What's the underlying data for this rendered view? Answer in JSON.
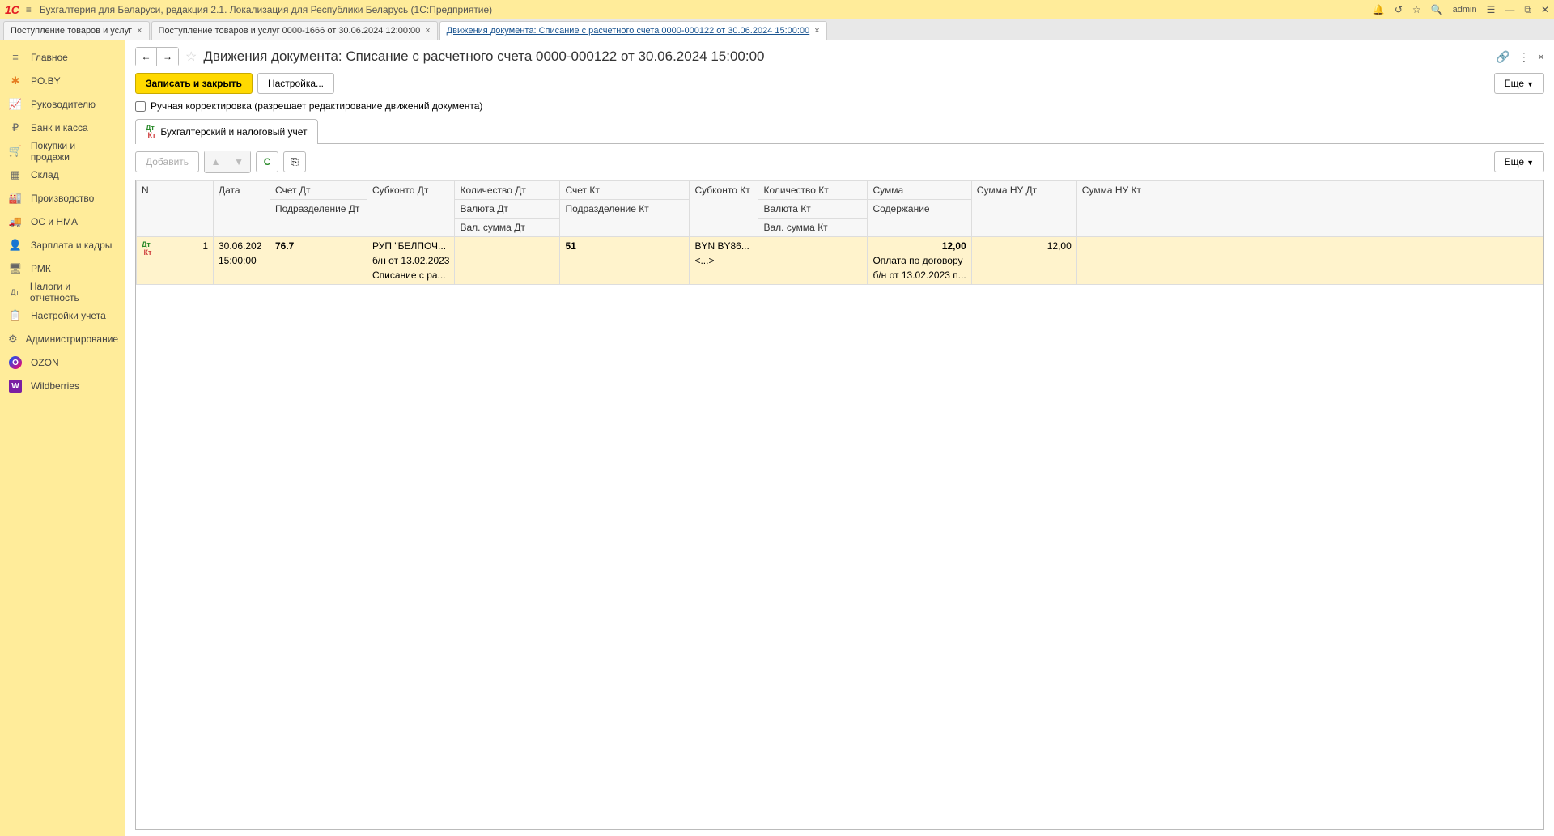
{
  "titlebar": {
    "app_name": "Бухгалтерия для Беларуси, редакция 2.1. Локализация для Республики Беларусь   (1С:Предприятие)",
    "user": "admin"
  },
  "tabs": [
    {
      "label": "Поступление товаров и услуг",
      "active": false,
      "highlight": false
    },
    {
      "label": "Поступление товаров и услуг 0000-1666 от 30.06.2024 12:00:00",
      "active": false,
      "highlight": false
    },
    {
      "label": "Движения документа: Списание с расчетного счета 0000-000122 от 30.06.2024 15:00:00",
      "active": true,
      "highlight": true
    }
  ],
  "sidebar": {
    "items": [
      {
        "label": "Главное",
        "icon": "≡",
        "cls": "ic-gray"
      },
      {
        "label": "PO.BY",
        "icon": "✱",
        "cls": "ic-orange"
      },
      {
        "label": "Руководителю",
        "icon": "📈",
        "cls": "ic-gray"
      },
      {
        "label": "Банк и касса",
        "icon": "₽",
        "cls": "ic-gray"
      },
      {
        "label": "Покупки и продажи",
        "icon": "🛒",
        "cls": "ic-gray"
      },
      {
        "label": "Склад",
        "icon": "▦",
        "cls": "ic-gray"
      },
      {
        "label": "Производство",
        "icon": "🏭",
        "cls": "ic-gray"
      },
      {
        "label": "ОС и НМА",
        "icon": "🚚",
        "cls": "ic-gray"
      },
      {
        "label": "Зарплата и кадры",
        "icon": "👤",
        "cls": "ic-gray"
      },
      {
        "label": "РМК",
        "icon": "🖥",
        "cls": "ic-gray"
      },
      {
        "label": "Налоги и отчетность",
        "icon": "Дт",
        "cls": "ic-gray"
      },
      {
        "label": "Настройки учета",
        "icon": "📋",
        "cls": "ic-gray"
      },
      {
        "label": "Администрирование",
        "icon": "⚙",
        "cls": "ic-gray"
      },
      {
        "label": "OZON",
        "icon": "O",
        "cls": "ic-ozon"
      },
      {
        "label": "Wildberries",
        "icon": "W",
        "cls": "ic-wb"
      }
    ]
  },
  "page": {
    "title": "Движения документа: Списание с расчетного счета 0000-000122 от 30.06.2024 15:00:00",
    "save_close": "Записать и закрыть",
    "settings": "Настройка...",
    "more": "Еще",
    "checkbox_label": "Ручная корректировка (разрешает редактирование движений документа)",
    "inner_tab": "Бухгалтерский и налоговый учет",
    "add": "Добавить"
  },
  "table": {
    "headers": {
      "n": "N",
      "date": "Дата",
      "acct_dt": "Счет Дт",
      "div_dt": "Подразделение Дт",
      "subkonto_dt": "Субконто Дт",
      "qty_dt": "Количество Дт",
      "currency_dt": "Валюта Дт",
      "val_sum_dt": "Вал. сумма Дт",
      "acct_kt": "Счет Кт",
      "div_kt": "Подразделение Кт",
      "subkonto_kt": "Субконто Кт",
      "qty_kt": "Количество Кт",
      "currency_kt": "Валюта Кт",
      "val_sum_kt": "Вал. сумма Кт",
      "sum": "Сумма",
      "content": "Содержание",
      "sum_nu_dt": "Сумма НУ Дт",
      "sum_nu_kt": "Сумма НУ Кт"
    },
    "rows": [
      {
        "n": "1",
        "date_line1": "30.06.202",
        "date_line2": "15:00:00",
        "acct_dt": "76.7",
        "subkonto_dt_1": "РУП \"БЕЛПОЧ...",
        "subkonto_dt_2": "б/н от 13.02.2023",
        "subkonto_dt_3": "Списание с ра...",
        "acct_kt": "51",
        "subkonto_kt_1": "BYN BY86...",
        "subkonto_kt_2": "<...>",
        "sum": "12,00",
        "content_1": "Оплата по договору",
        "content_2": "б/н от 13.02.2023 п...",
        "sum_nu_dt": "12,00"
      }
    ]
  }
}
